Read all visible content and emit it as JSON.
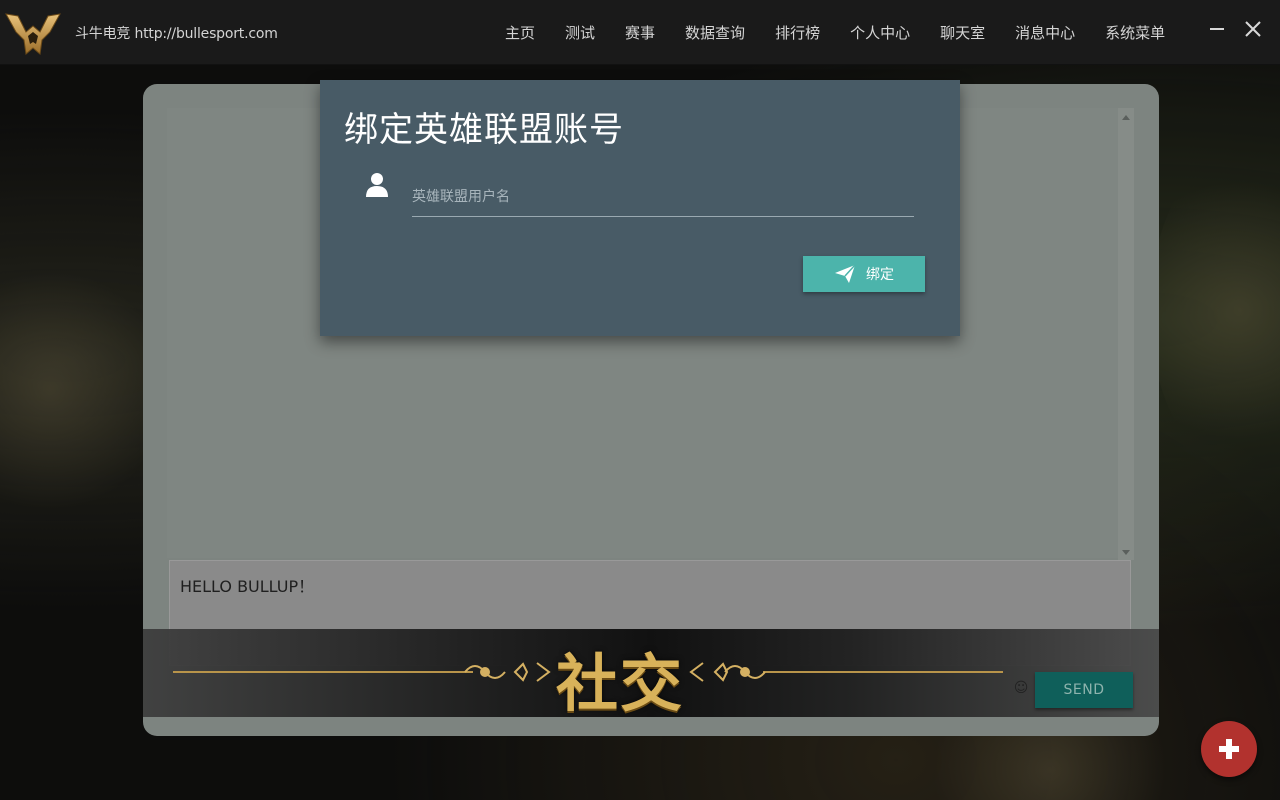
{
  "header": {
    "brand": "斗牛电竞 http://bullesport.com",
    "logo_icon": "bull-horns-logo",
    "nav": [
      {
        "label": "主页"
      },
      {
        "label": "测试"
      },
      {
        "label": "赛事"
      },
      {
        "label": "数据查询"
      },
      {
        "label": "排行榜"
      },
      {
        "label": "个人中心"
      },
      {
        "label": "聊天室"
      },
      {
        "label": "消息中心"
      },
      {
        "label": "系统菜单"
      }
    ],
    "window_controls": [
      "minimize-icon",
      "close-icon"
    ]
  },
  "chat": {
    "input_value": "HELLO BULLUP！",
    "banner_text": "社交",
    "emoji": "☺",
    "send_label": "SEND"
  },
  "modal": {
    "title": "绑定英雄联盟账号",
    "username_placeholder": "英雄联盟用户名",
    "bind_label": "绑定",
    "user_icon": "user-icon",
    "bind_icon": "paper-plane-icon"
  },
  "fab": {
    "icon": "plus-icon"
  },
  "colors": {
    "topbar_bg": "#1a1a1a",
    "panel_bg": "#7d8480",
    "modal_bg": "#485b66",
    "bind_button": "#4cb4ab",
    "send_button": "#0f5f5a",
    "fab": "#b2322e",
    "banner_gold": "#c9a24a"
  }
}
